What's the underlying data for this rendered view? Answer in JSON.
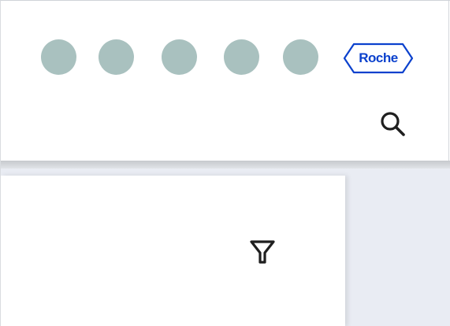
{
  "header": {
    "nav_dots": [
      {
        "name": "nav-item-1"
      },
      {
        "name": "nav-item-2"
      },
      {
        "name": "nav-item-3"
      },
      {
        "name": "nav-item-4"
      },
      {
        "name": "nav-item-5"
      }
    ],
    "logo": {
      "text": "Roche"
    },
    "search_icon": "search-icon"
  },
  "panel": {
    "filter_icon": "filter-icon"
  },
  "colors": {
    "nav_dot": "#a9c1bf",
    "logo_blue": "#0b41cd",
    "icon_dark": "#1f1f1f",
    "page_bg": "#e9ecf3"
  }
}
